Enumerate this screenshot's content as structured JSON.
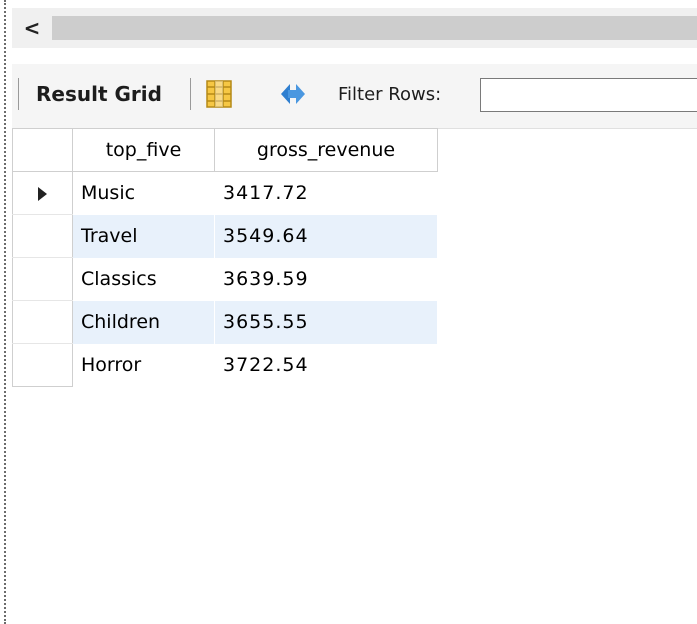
{
  "scrollbar": {
    "left_arrow": "<"
  },
  "toolbar": {
    "result_grid_label": "Result Grid",
    "grid_icon": "grid-layout-icon",
    "refresh_icon": "refresh-icon",
    "filter_label": "Filter Rows:",
    "filter_value": "",
    "filter_placeholder": ""
  },
  "grid": {
    "columns": [
      "top_five",
      "gross_revenue"
    ],
    "rows": [
      {
        "top_five": "Music",
        "gross_revenue": "3417.72"
      },
      {
        "top_five": "Travel",
        "gross_revenue": "3549.64"
      },
      {
        "top_five": "Classics",
        "gross_revenue": "3639.59"
      },
      {
        "top_five": "Children",
        "gross_revenue": "3655.55"
      },
      {
        "top_five": "Horror",
        "gross_revenue": "3722.54"
      }
    ],
    "selected_row_index": 0
  },
  "colors": {
    "alt_row": "#e8f1fb",
    "toolbar_bg": "#f5f5f5",
    "refresh_blue": "#2f7fd0"
  }
}
